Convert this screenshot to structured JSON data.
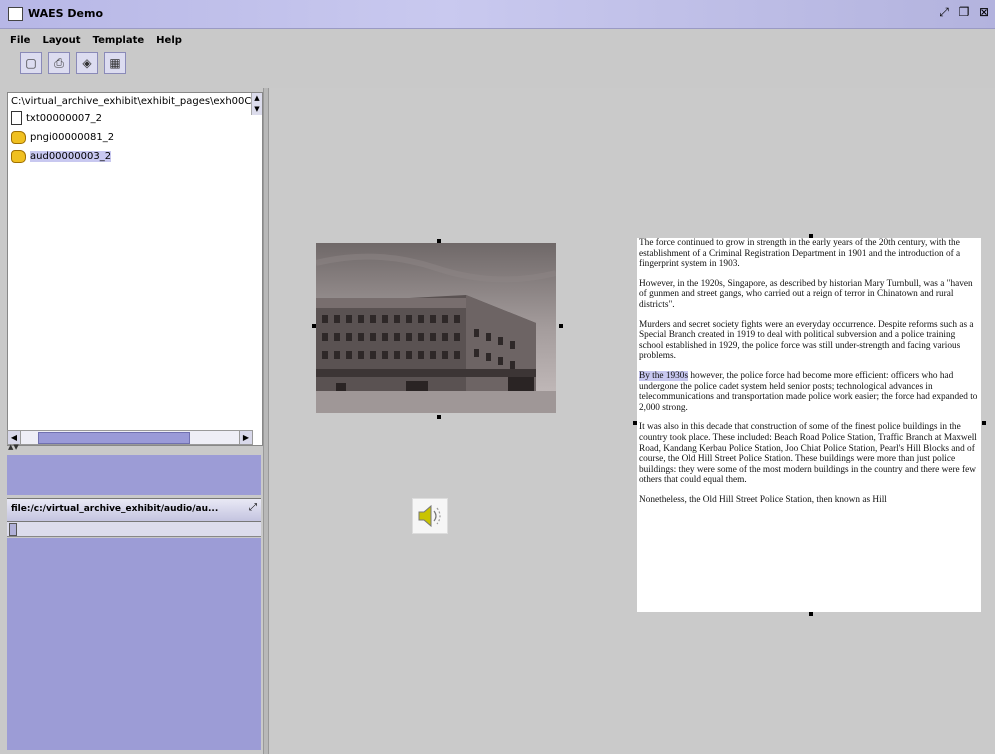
{
  "window": {
    "title": "WAES Demo"
  },
  "menu": [
    "File",
    "Layout",
    "Template",
    "Help"
  ],
  "toolbar": [
    {
      "name": "new-document-button",
      "icon": "page-icon",
      "glyph": "D"
    },
    {
      "name": "print-button",
      "icon": "print-icon",
      "glyph": "⎙"
    },
    {
      "name": "preview-button",
      "icon": "eye-icon",
      "glyph": "◈"
    },
    {
      "name": "template-button",
      "icon": "template-icon",
      "glyph": "▦"
    }
  ],
  "tree": {
    "root": "C:\\virtual_archive_exhibit\\exhibit_pages\\exh00C",
    "items": [
      {
        "label": "txt00000007_2",
        "icon": "document-icon"
      },
      {
        "label": "pngi00000081_2",
        "icon": "folder-icon"
      },
      {
        "label": "aud00000003_2",
        "icon": "folder-icon",
        "selected": true
      }
    ]
  },
  "audio_panel": {
    "path": "file:/c:/virtual_archive_exhibit/audio/au..."
  },
  "textbox": {
    "paragraphs": [
      {
        "text": "The force continued to grow in strength in the early years of the 20th century, with the establishment of a Criminal Registration Department in 1901 and the introduction of a fingerprint system in 1903."
      },
      {
        "text": "However, in the 1920s, Singapore, as described by historian Mary Turnbull, was a \"haven of gunmen and street gangs, who carried out a reign of terror in Chinatown and rural districts\"."
      },
      {
        "text": "Murders and secret society fights were an everyday occurrence. Despite reforms such as a Special Branch created in 1919 to deal with political subversion and a police training school established in 1929, the police force was still under-strength and facing various problems."
      },
      {
        "highlight": "By the 1930s",
        "text": " however, the police force had become more efficient: officers who had undergone the police cadet system held senior posts; technological advances in telecommunications and transportation made police work easier; the force had expanded to 2,000 strong."
      },
      {
        "text": "It was also in this decade that construction of some of the finest police buildings in the country took place. These included: Beach Road Police Station, Traffic Branch at Maxwell Road, Kandang Kerbau Police Station, Joo Chiat Police Station, Pearl's Hill Blocks and of course, the Old Hill Street Police Station. These buildings were more than just police buildings: they were some of the most modern buildings in the country and there were few others that could equal them."
      },
      {
        "text": "Nonetheless, the Old Hill Street Police Station, then known as Hill"
      }
    ]
  },
  "image": {
    "subject": "historic-building-photo"
  },
  "colors": {
    "panel_purple": "#9c9cd6",
    "titlebar": "#c0c0ea",
    "canvas": "#cacaca"
  }
}
